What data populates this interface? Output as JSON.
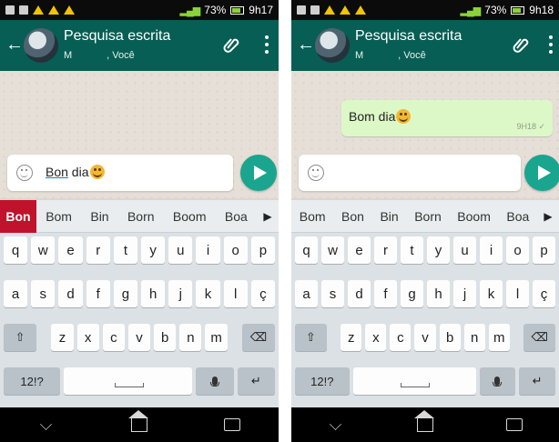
{
  "screens": [
    {
      "status": {
        "battery": "73%",
        "time": "9h17"
      },
      "chat_title": "Pesquisa escrita",
      "chat_subtitle_left": "M",
      "chat_subtitle_right": ", Você",
      "message": null,
      "input": {
        "prefix": "Bon",
        "suffix": " dia"
      },
      "suggestions": [
        "Bon",
        "Bom",
        "Bin",
        "Born",
        "Boom",
        "Boa"
      ],
      "active_suggestion": "Bon"
    },
    {
      "status": {
        "battery": "73%",
        "time": "9h18"
      },
      "chat_title": "Pesquisa escrita",
      "chat_subtitle_left": "M",
      "chat_subtitle_right": ", Você",
      "message": {
        "text": "Bom dia",
        "time": "9H18 ✓"
      },
      "input": {
        "prefix": "",
        "suffix": ""
      },
      "suggestions": [
        "Bom",
        "Bon",
        "Bin",
        "Born",
        "Boom",
        "Boa"
      ],
      "active_suggestion": null
    }
  ],
  "keyboard": {
    "row1": [
      "q",
      "w",
      "e",
      "r",
      "t",
      "y",
      "u",
      "i",
      "o",
      "p"
    ],
    "row2": [
      "a",
      "s",
      "d",
      "f",
      "g",
      "h",
      "j",
      "k",
      "l",
      "ç"
    ],
    "row3": [
      "z",
      "x",
      "c",
      "v",
      "b",
      "n",
      "m"
    ],
    "symbols_label": "12!?"
  },
  "icons": {
    "back": "arrow-left-icon",
    "attach": "paperclip-icon",
    "menu": "overflow-menu-icon",
    "emoji": "smiley-icon",
    "send": "send-icon",
    "suggestion_more": "chevron-right-icon",
    "shift": "shift-icon",
    "delete": "backspace-icon",
    "mic": "microphone-icon",
    "enter": "enter-icon",
    "nav_back": "nav-back-icon",
    "nav_home": "nav-home-icon",
    "nav_recent": "nav-recent-icon"
  },
  "colors": {
    "app_bar": "#075e54",
    "send_button": "#1aa58f",
    "bubble": "#dcf8c6",
    "active_suggestion": "#c0132b"
  }
}
